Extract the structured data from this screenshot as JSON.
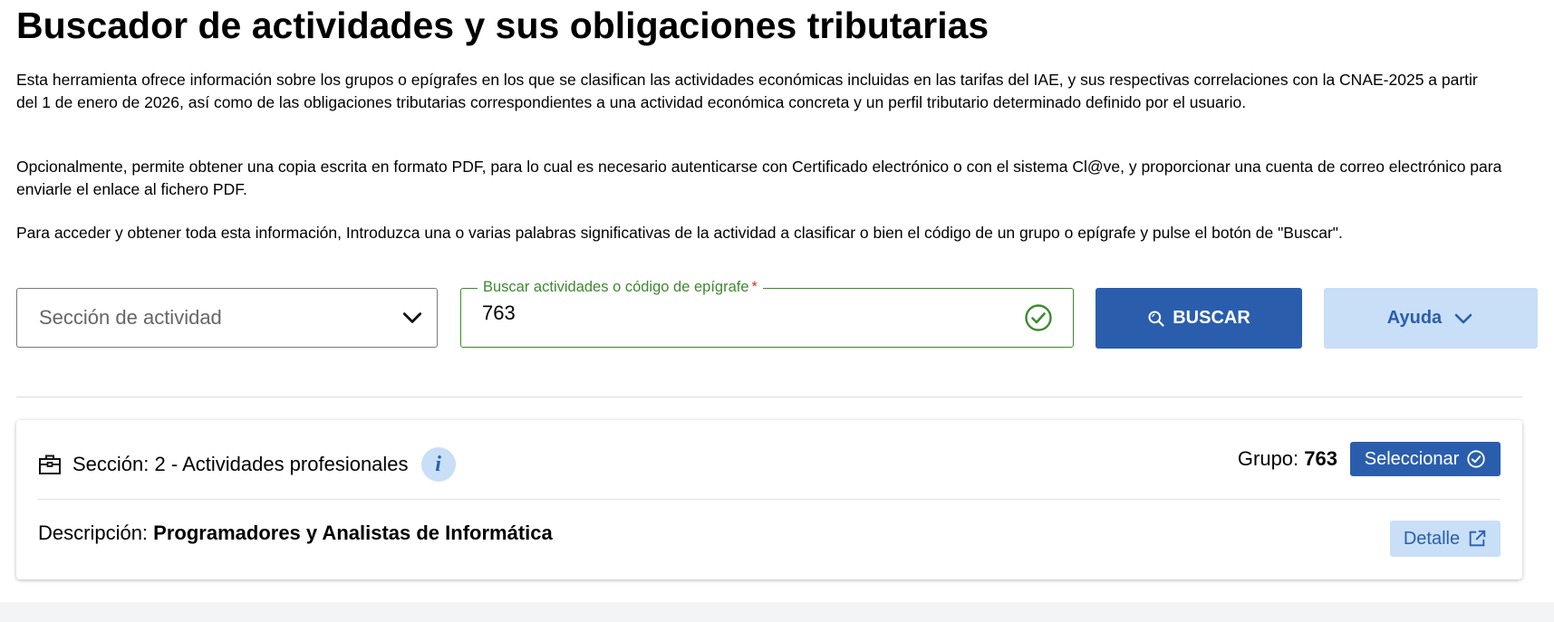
{
  "page": {
    "title": "Buscador de actividades y sus obligaciones tributarias",
    "paragraphs": [
      "Esta herramienta ofrece información sobre los grupos o epígrafes en los que se clasifican las actividades económicas incluidas en las tarifas del IAE, y sus respectivas correlaciones con la CNAE-2025 a partir del 1 de enero de 2026, así como de las obligaciones tributarias correspondientes a una actividad económica concreta y un perfil tributario determinado definido por el usuario.",
      "Opcionalmente, permite obtener una copia escrita en formato PDF, para lo cual es necesario autenticarse con Certificado electrónico o con el sistema Cl@ve, y proporcionar una cuenta de correo electrónico para enviarle el enlace al fichero PDF.",
      "Para acceder y obtener toda esta información, Introduzca una o varias palabras significativas de la actividad a clasificar o bien el código de un grupo o epígrafe y pulse el botón de \"Buscar\"."
    ]
  },
  "search": {
    "section_placeholder": "Sección de actividad",
    "field_label": "Buscar actividades o código de epígrafe",
    "required_mark": "*",
    "value": "763",
    "buscar_label": "BUSCAR",
    "ayuda_label": "Ayuda"
  },
  "result": {
    "seccion_text": "Sección: 2 - Actividades profesionales",
    "info_glyph": "i",
    "grupo_label": "Grupo:",
    "grupo_value": "763",
    "seleccionar_label": "Seleccionar",
    "desc_label": "Descripción:",
    "desc_value": "Programadores y Analistas de Informática",
    "detalle_label": "Detalle"
  },
  "colors": {
    "primary": "#2a5ead",
    "primary_light": "#c8dff7",
    "success": "#3d8a2e",
    "required": "#d0342c"
  },
  "icons": [
    "chevron-down-icon",
    "check-circle-icon",
    "search-icon",
    "briefcase-icon",
    "info-icon",
    "check-circle-icon",
    "external-link-icon"
  ]
}
